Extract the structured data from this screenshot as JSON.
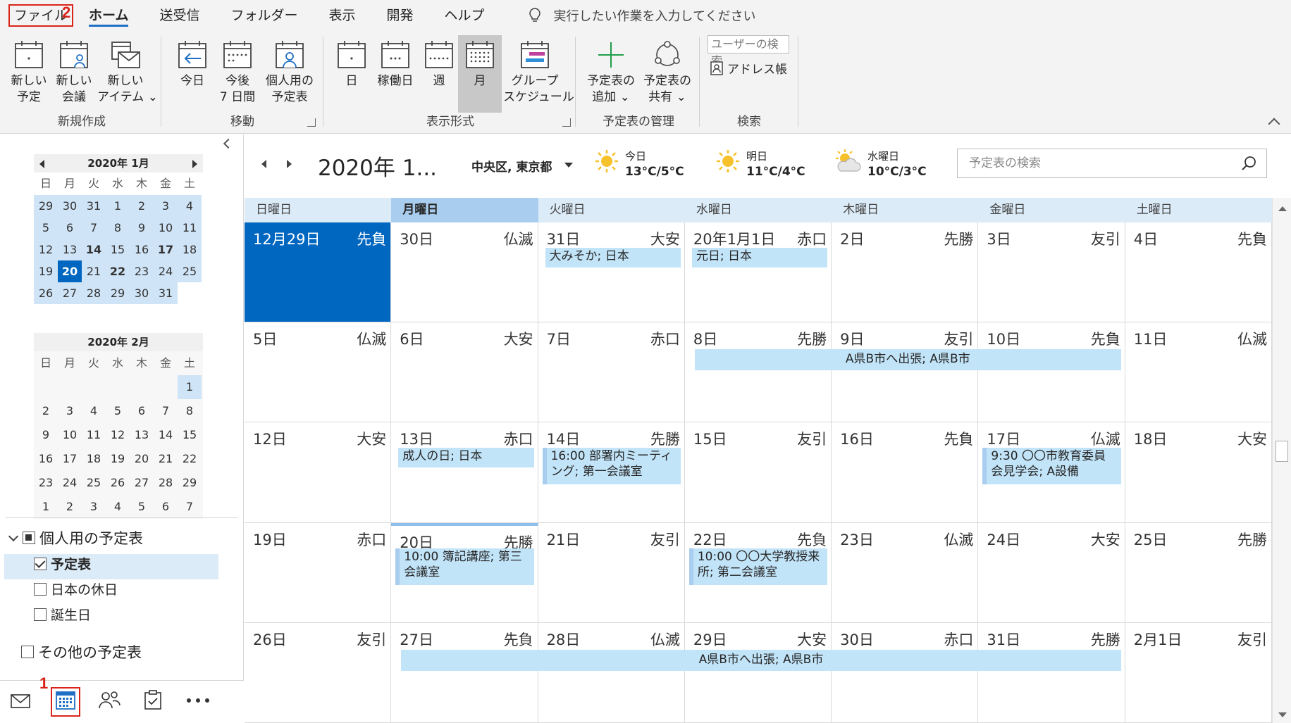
{
  "menu": {
    "file": "ファイル",
    "home": "ホーム",
    "send_receive": "送受信",
    "folder": "フォルダー",
    "view": "表示",
    "developer": "開発",
    "help": "ヘルプ",
    "tell_me": "実行したい作業を入力してください"
  },
  "steps": {
    "one": "1",
    "two": "2"
  },
  "ribbon": {
    "new_group": "新規作成",
    "move_group": "移動",
    "view_group": "表示形式",
    "manage_group": "予定表の管理",
    "search_group": "検索",
    "new_appointment": "新しい\n予定",
    "new_meeting": "新しい\n会議",
    "new_items": "新しい\nアイテム ⌄",
    "today": "今日",
    "next7": "今後\n7 日間",
    "personal_cal": "個人用の\n予定表",
    "day": "日",
    "work_week": "稼働日",
    "week": "週",
    "month": "月",
    "group_schedule": "グループ\nスケジュール",
    "add_calendar": "予定表の\n追加 ⌄",
    "share_calendar": "予定表の\n共有 ⌄",
    "search_people": "ユーザーの検索",
    "address_book": "アドレス帳"
  },
  "minical_jan": {
    "title": "2020年 1月",
    "dow": [
      "日",
      "月",
      "火",
      "水",
      "木",
      "金",
      "土"
    ],
    "days": [
      "29",
      "30",
      "31",
      "1",
      "2",
      "3",
      "4",
      "5",
      "6",
      "7",
      "8",
      "9",
      "10",
      "11",
      "12",
      "13",
      "14",
      "15",
      "16",
      "17",
      "18",
      "19",
      "20",
      "21",
      "22",
      "23",
      "24",
      "25",
      "26",
      "27",
      "28",
      "29",
      "30",
      "31"
    ]
  },
  "minical_feb": {
    "title": "2020年 2月",
    "dow": [
      "日",
      "月",
      "火",
      "水",
      "木",
      "金",
      "土"
    ],
    "days": [
      "1",
      "2",
      "3",
      "4",
      "5",
      "6",
      "7",
      "8",
      "9",
      "10",
      "11",
      "12",
      "13",
      "14",
      "15",
      "16",
      "17",
      "18",
      "19",
      "20",
      "21",
      "22",
      "23",
      "24",
      "25",
      "26",
      "27",
      "28",
      "29",
      "1",
      "2",
      "3",
      "4",
      "5",
      "6",
      "7"
    ]
  },
  "tree": {
    "my_calendars": "個人用の予定表",
    "calendar": "予定表",
    "japan_holidays": "日本の休日",
    "birthdays": "誕生日",
    "other_calendars": "その他の予定表"
  },
  "calendar": {
    "title": "2020年 1...",
    "location": "中央区, 東京都",
    "weather": [
      {
        "day": "今日",
        "temp": "13°C/5°C"
      },
      {
        "day": "明日",
        "temp": "11°C/4°C"
      },
      {
        "day": "水曜日",
        "temp": "10°C/3°C"
      }
    ],
    "search_placeholder": "予定表の検索",
    "dow": [
      "日曜日",
      "月曜日",
      "火曜日",
      "水曜日",
      "木曜日",
      "金曜日",
      "土曜日"
    ],
    "weeks": [
      [
        [
          "12月29日",
          "先負"
        ],
        [
          "30日",
          "仏滅"
        ],
        [
          "31日",
          "大安"
        ],
        [
          "20年1月1日",
          "赤口"
        ],
        [
          "2日",
          "先勝"
        ],
        [
          "3日",
          "友引"
        ],
        [
          "4日",
          "先負"
        ]
      ],
      [
        [
          "5日",
          "仏滅"
        ],
        [
          "6日",
          "大安"
        ],
        [
          "7日",
          "赤口"
        ],
        [
          "8日",
          "先勝"
        ],
        [
          "9日",
          "友引"
        ],
        [
          "10日",
          "先負"
        ],
        [
          "11日",
          "仏滅"
        ]
      ],
      [
        [
          "12日",
          "大安"
        ],
        [
          "13日",
          "赤口"
        ],
        [
          "14日",
          "先勝"
        ],
        [
          "15日",
          "友引"
        ],
        [
          "16日",
          "先負"
        ],
        [
          "17日",
          "仏滅"
        ],
        [
          "18日",
          "大安"
        ]
      ],
      [
        [
          "19日",
          "赤口"
        ],
        [
          "20日",
          "先勝"
        ],
        [
          "21日",
          "友引"
        ],
        [
          "22日",
          "先負"
        ],
        [
          "23日",
          "仏滅"
        ],
        [
          "24日",
          "大安"
        ],
        [
          "25日",
          "先勝"
        ]
      ],
      [
        [
          "26日",
          "友引"
        ],
        [
          "27日",
          "先負"
        ],
        [
          "28日",
          "仏滅"
        ],
        [
          "29日",
          "大安"
        ],
        [
          "30日",
          "赤口"
        ],
        [
          "31日",
          "先勝"
        ],
        [
          "2月1日",
          "友引"
        ]
      ]
    ],
    "events": {
      "omisoka": "大みそか; 日本",
      "ganjitsu": "元日; 日本",
      "trip1": "A県B市へ出張; A県B市",
      "seijin": "成人の日; 日本",
      "meeting": "16:00 部署内ミーティング; 第一会議室",
      "visit": "9:30 〇〇市教育委員会見学会; A設備",
      "boki": "10:00 簿記講座; 第三会議室",
      "professor": "10:00 〇〇大学教授来所; 第二会議室",
      "trip2": "A県B市へ出張; A県B市"
    }
  }
}
